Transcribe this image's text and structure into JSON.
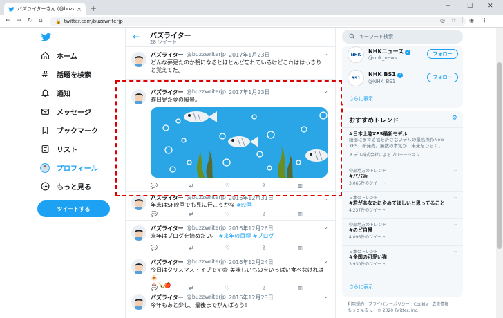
{
  "browser": {
    "tab_title": "バズライターさん (@buzzwriterjp) / T",
    "tab_close": "×",
    "new_tab": "+",
    "url": "twitter.com/buzzwriterjp"
  },
  "nav": {
    "items": [
      {
        "label": "ホーム",
        "icon": "home-icon"
      },
      {
        "label": "話題を検索",
        "icon": "hashtag-icon"
      },
      {
        "label": "通知",
        "icon": "bell-icon"
      },
      {
        "label": "メッセージ",
        "icon": "mail-icon"
      },
      {
        "label": "ブックマーク",
        "icon": "bookmark-icon"
      },
      {
        "label": "リスト",
        "icon": "list-icon"
      },
      {
        "label": "プロフィール",
        "icon": "avatar-icon"
      },
      {
        "label": "もっと見る",
        "icon": "more-icon"
      }
    ],
    "tweet_button": "ツイートする",
    "colors": {
      "accent": "#1da1f2"
    }
  },
  "profile": {
    "name": "バズライター",
    "tweet_count": "28 ツイート"
  },
  "tweets": [
    {
      "name": "バズライター",
      "handle": "@buzzwriterjp",
      "date": "2017年1月23日",
      "text": "どんな夢見たのか朝になるとほとんど忘れているけどこれははっきりと覚えてた。"
    },
    {
      "name": "バズライター",
      "handle": "@buzzwriterjp",
      "date": "2017年1月23日",
      "text": "昨日見た夢の風景。"
    },
    {
      "name": "バズライター",
      "handle": "@buzzwriterjp",
      "date": "2016年12月31日",
      "text": "年末はSF映画でも見に行こうかな",
      "tags": [
        "#映画"
      ]
    },
    {
      "name": "バズライター",
      "handle": "@buzzwriterjp",
      "date": "2016年12月26日",
      "text": "来年はブログを始めたい。",
      "tags": [
        "#来年の目標",
        "#ブログ"
      ]
    },
    {
      "name": "バズライター",
      "handle": "@buzzwriterjp",
      "date": "2016年12月24日",
      "text": "今日はクリスマス・イブです😊 美味しいものをいっぱい食べなければ🍝",
      "text2": "🎂🍾🍎"
    },
    {
      "name": "バズライター",
      "handle": "@buzzwriterjp",
      "date": "2016年12月23日",
      "text": "今年もあと少し。最後までがんばろう！"
    }
  ],
  "sidebar": {
    "search_placeholder": "キーワード検索",
    "accounts": [
      {
        "name": "NHKニュース",
        "handle": "@nhk_news",
        "logo": "NHK",
        "follow": "フォロー"
      },
      {
        "name": "NHK BS1",
        "handle": "@NHK_BS1",
        "logo": "BS1",
        "follow": "フォロー"
      }
    ],
    "show_more": "さらに表示",
    "trends_title": "おすすめトレンド",
    "promo": {
      "name": "#日本上陸XPS最新モデル",
      "desc": "細部にまで妥協を許さないデルの最高傑作New XPS、新発売。無数の本気が、未来をひらく。",
      "by": "デル株式会社によるプロモーション"
    },
    "trends": [
      {
        "context": "中部地方のトレンド",
        "name": "#パパ活",
        "count": "3,065件のツイート"
      },
      {
        "context": "日本のトレンド",
        "name": "#君があなたにやめてほしいと思ってること",
        "count": "4,237件のツイート"
      },
      {
        "context": "中部地方のトレンド",
        "name": "#のど自慢",
        "count": "4,096件のツイート"
      },
      {
        "context": "日本のトレンド",
        "name": "#全国の可愛い猫",
        "count": "3,930件のツイート"
      }
    ],
    "footer_line1": "利用規約　プライバシーポリシー　Cookie　広告情報",
    "footer_line2": "もっと見る ⌄　© 2020 Twitter, Inc."
  }
}
